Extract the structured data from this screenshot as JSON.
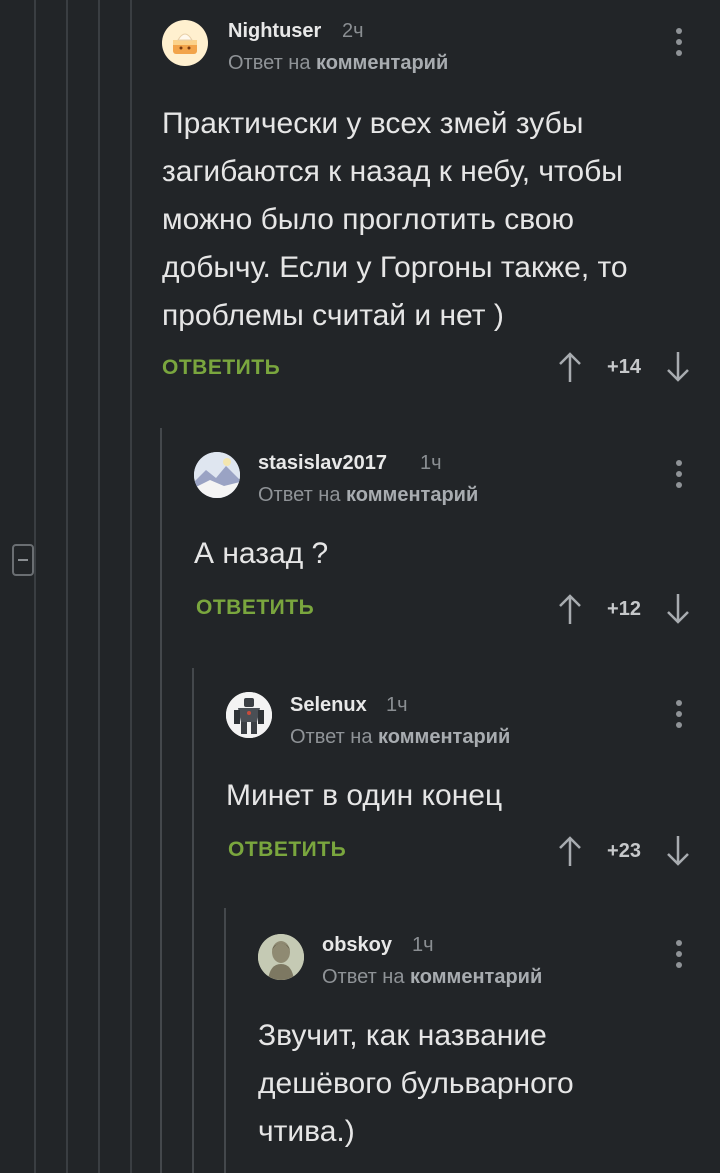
{
  "ui": {
    "reply_prefix": "Ответ на",
    "reply_target": "комментарий",
    "reply_label": "ОТВЕТИТЬ"
  },
  "comments": [
    {
      "username": "Nightuser",
      "time": "2ч",
      "text": "Практически у всех змей зубы загибаются к назад к небу, чтобы можно было проглотить свою добычу. Если у Горгоны также, то проблемы считай и нет )",
      "score": "+14",
      "avatar_icon": "cake-avatar"
    },
    {
      "username": "stasislav2017",
      "time": "1ч",
      "text": "А назад ?",
      "score": "+12",
      "avatar_icon": "landscape-avatar"
    },
    {
      "username": "Selenux",
      "time": "1ч",
      "text": "Минет в один конец",
      "score": "+23",
      "avatar_icon": "robot-avatar"
    },
    {
      "username": "obskoy",
      "time": "1ч",
      "text": "Звучит, как название дешёвого бульварного чтива.)",
      "avatar_icon": "statue-avatar"
    }
  ],
  "colors": {
    "background": "#222528",
    "accent": "#7aa63e",
    "muted": "#8a8e92"
  }
}
